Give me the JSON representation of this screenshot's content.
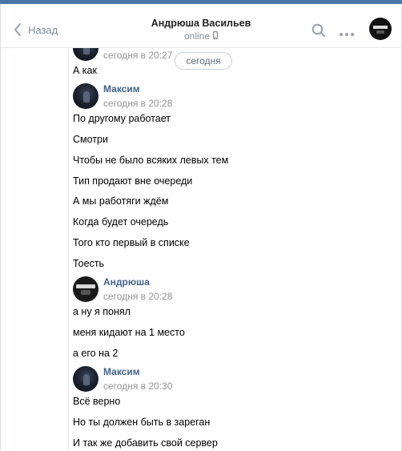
{
  "header": {
    "back_label": "Назад",
    "title": "Андрюша Васильев",
    "status": "online"
  },
  "feed": {
    "date_separator": "сегодня",
    "partial_top": {
      "time": "сегодня в 20:27",
      "message": "А как"
    },
    "groups": [
      {
        "author": "Максим",
        "time": "сегодня в 20:28",
        "messages": [
          "По другому работает",
          "Смотри",
          "Чтобы не было всяких левых тем",
          "Тип продают вне очереди",
          "А мы работяги ждём",
          "Когда будет очередь",
          "Того кто первый в списке",
          "Тоесть"
        ]
      },
      {
        "author": "Андрюша",
        "time": "сегодня в 20:28",
        "messages": [
          "а ну я понял",
          "меня кидают на 1 место",
          "а его на 2"
        ]
      },
      {
        "author": "Максим",
        "time": "сегодня в 20:30",
        "messages": [
          "Всё верно",
          "Но ты должен быть в зареган",
          "И так же добавить свой сервер"
        ]
      }
    ]
  },
  "icons": {
    "back": "chevron-left-icon",
    "status_device": "mobile-phone-icon",
    "search": "search-icon",
    "more": "more-dots-icon"
  },
  "colors": {
    "accent": "#4a76a8",
    "author_name": "#42648b",
    "muted": "#939393"
  }
}
